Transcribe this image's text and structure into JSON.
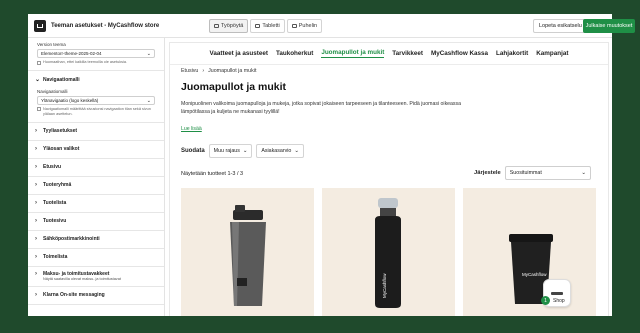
{
  "app": {
    "title": "Teeman asetukset - MyCashflow store"
  },
  "devices": [
    {
      "label": "Työpöytä",
      "active": true
    },
    {
      "label": "Tabletti",
      "active": false
    },
    {
      "label": "Puhelin",
      "active": false
    }
  ],
  "toolbar": {
    "stop_label": "Lopeta esikatselu",
    "publish_label": "Julkaise muutokset"
  },
  "sidebar": {
    "version_label": "Version teema",
    "version_value": "Elementorr-theme-2025-02-04",
    "version_note": "Huomaathan, ettei kaikilla teemoilla ole asetuksia.",
    "nav_model": {
      "title": "Navigaatiomalli",
      "label": "Navigaatiomalli",
      "value": "Ylänavigaatio (logo keskellä)",
      "note": "Navigaatiomalli määrittää sivustonsi navigaation tilan sekä sivun ylälaan asettelun."
    },
    "items": [
      "Tyyliasetukset",
      "Yläosan valikot",
      "Etusivu",
      "Tuoteryhmä",
      "Tuotelista",
      "Tuotesivu",
      "Sähköpostimarkkinointi",
      "Toimelista",
      "Maksu- ja toimitustavakkeet",
      "Klarna On-site messaging"
    ],
    "payment_sub": "Näytä saatavilla olevat maksu- ja toimitustavat"
  },
  "store": {
    "nav": [
      "Vaatteet ja asusteet",
      "Taukoherkut",
      "Juomapullot ja mukit",
      "Tarvikkeet",
      "MyCashflow Kassa",
      "Lahjakortit",
      "Kampanjat"
    ],
    "active_nav": "Juomapullot ja mukit",
    "breadcrumb": [
      "Etusivu",
      "Juomapullot ja mukit"
    ],
    "breadcrumb_sep": "›",
    "title": "Juomapullot ja mukit",
    "description": "Monipuolinen valikoima juomapulloja ja mukeja, jotka sopivat jokaiseen tarpeeseen ja tilanteeseen. Pidä juomasi oikeassa lämpötilassa ja kuljeta ne mukanasi tyylillä!",
    "read_more": "Lue lisää",
    "filter_label": "Suodata",
    "filters": [
      "Muu rajaus",
      "Asiakasarvio"
    ],
    "count_text": "Näytetään tuotteet 1-3 / 3",
    "sort_label": "Järjestele",
    "sort_value": "Suosituimmat",
    "product_brand": "MyCashflow",
    "shop_label": "Shop",
    "shop_count": "1"
  },
  "icons": {
    "chevron_down": "⌄",
    "arrow_right": "›"
  },
  "colors": {
    "accent": "#1f8f46",
    "background": "#1f4a2c",
    "card": "#f4ece1"
  }
}
